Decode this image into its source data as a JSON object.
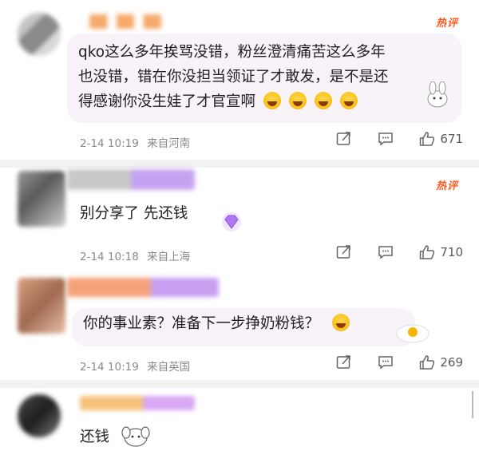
{
  "hot_badge": "热评",
  "comments": [
    {
      "text_lines": [
        "qko这么多年挨骂没错，粉丝澄清痛苦这么多年",
        "也没错，错在你没担当领证了才敢发，是不是还",
        "得感谢你没生娃了才官宣啊"
      ],
      "emoji": "😂😂😂😂",
      "time": "2-14 10:19",
      "location": "来自河南",
      "likes": "671"
    },
    {
      "text_lines": [
        "别分享了 先还钱"
      ],
      "time": "2-14 10:18",
      "location": "来自上海",
      "likes": "710"
    },
    {
      "text_lines": [
        "你的事业素？准备下一步挣奶粉钱？"
      ],
      "time": "2-14 10:19",
      "location": "来自英国",
      "likes": "269"
    },
    {
      "text_lines": [
        "还钱"
      ]
    }
  ],
  "icons": {
    "share": "share-icon",
    "comment": "comment-icon",
    "like": "like-icon"
  },
  "colors": {
    "hot": "#ff5a1f",
    "meta": "#8a8a8a",
    "bubble": "#f7f3f9"
  }
}
